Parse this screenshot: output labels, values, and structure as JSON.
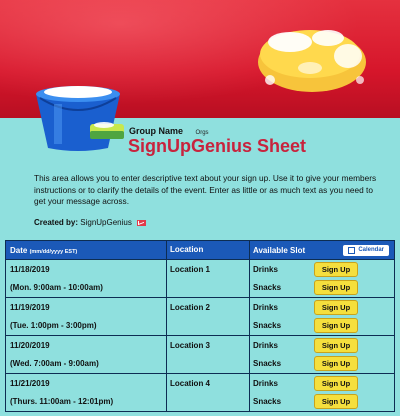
{
  "header": {
    "group_label": "Group Name",
    "group_value": "Orgs",
    "title": "SignUpGenius Sheet"
  },
  "description": "This area allows you to enter descriptive text about your sign up. Use it to give your members instructions or to clarify the details of the event. Enter as little or as much text as you need to get your message across.",
  "created_by": {
    "label": "Created by:",
    "name": "SignUpGenius"
  },
  "table": {
    "col_date": "Date",
    "col_date_fmt": "(mm/dd/yyyy EST)",
    "col_location": "Location",
    "col_slot": "Available Slot",
    "calendar_label": "Calendar",
    "rows": [
      {
        "date": "11/18/2019",
        "time": "(Mon. 9:00am - 10:00am)",
        "location": "Location 1",
        "slots": [
          "Drinks",
          "Snacks"
        ]
      },
      {
        "date": "11/19/2019",
        "time": "(Tue. 1:00pm - 3:00pm)",
        "location": "Location 2",
        "slots": [
          "Drinks",
          "Snacks"
        ]
      },
      {
        "date": "11/20/2019",
        "time": "(Wed. 7:00am - 9:00am)",
        "location": "Location 3",
        "slots": [
          "Drinks",
          "Snacks"
        ]
      },
      {
        "date": "11/21/2019",
        "time": "(Thurs. 11:00am - 12:01pm)",
        "location": "Location 4",
        "slots": [
          "Drinks",
          "Snacks"
        ]
      }
    ],
    "signup_label": "Sign Up"
  },
  "colors": {
    "background": "#8fe0de",
    "banner": "#d6162b",
    "title": "#c8233d",
    "header_bar": "#1b59b8",
    "signup_button": "#f5df3d"
  },
  "icons": [
    "bucket-image",
    "sponge-image",
    "mail-icon",
    "calendar-icon"
  ]
}
